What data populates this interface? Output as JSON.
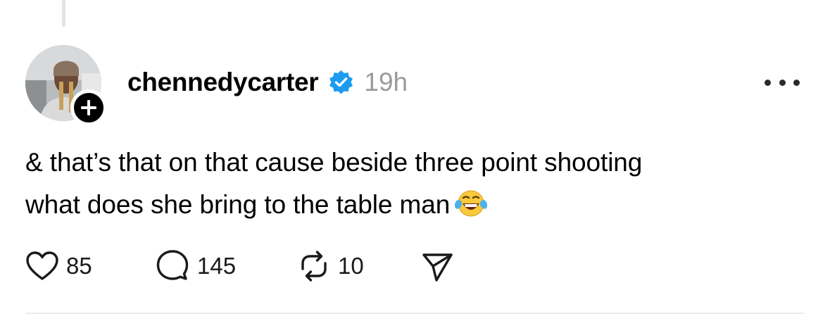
{
  "post": {
    "username": "chennedycarter",
    "verified_icon": "verified-badge-icon",
    "timestamp": "19h",
    "text_lines": [
      "& that’s that on that cause beside three point shooting",
      "what does she bring to the table man"
    ],
    "emoji": "face-with-tears-of-joy-icon"
  },
  "actions": {
    "like_count": "85",
    "reply_count": "145",
    "repost_count": "10"
  },
  "colors": {
    "verified_blue": "#1d9bf0",
    "timestamp_gray": "#9a9a9a",
    "text": "#000000",
    "divider": "#ececec"
  }
}
